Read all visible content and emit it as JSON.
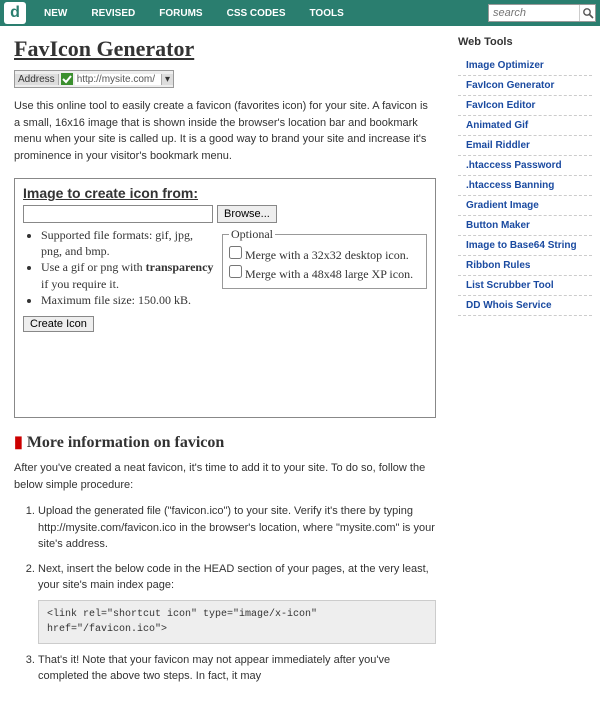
{
  "nav": {
    "items": [
      "NEW",
      "REVISED",
      "FORUMS",
      "CSS CODES",
      "TOOLS"
    ],
    "search_placeholder": "search"
  },
  "page": {
    "title": "FavIcon Generator",
    "address_label": "Address",
    "address_url": "http://mysite.com/",
    "intro": "Use this online tool to easily create a favicon (favorites icon) for your site. A favicon is a small, 16x16 image that is shown inside the browser's location bar and bookmark menu when your site is called up. It is a good way to brand your site and increase it's prominence in your visitor's bookmark menu."
  },
  "form": {
    "heading": "Image to create icon from:",
    "browse_label": "Browse...",
    "notes": [
      "Supported file formats: gif, jpg, png, and bmp.",
      "Use a gif or png with <b>transparency</b> if you require it.",
      "Maximum file size: 150.00 kB."
    ],
    "optional_legend": "Optional",
    "opt1": "Merge with a 32x32 desktop icon.",
    "opt2": "Merge with a 48x48 large XP icon.",
    "create_label": "Create Icon"
  },
  "more": {
    "heading": "More information on favicon",
    "after": "After you've created a neat favicon, it's time to add it to your site. To do so, follow the below simple procedure:",
    "step1": "Upload the generated file (\"favicon.ico\") to your site. Verify it's there by typing http://mysite.com/favicon.ico in the browser's location, where \"mysite.com\" is your site's address.",
    "step2": "Next, insert the below code in the HEAD section of your pages, at the very least, your site's main index page:",
    "code": "<link rel=\"shortcut icon\" type=\"image/x-icon\" href=\"/favicon.ico\">",
    "step3": "That's it! Note that your favicon may not appear immediately after you've completed the above two steps. In fact, it may"
  },
  "sidebar": {
    "title": "Web Tools",
    "links": [
      "Image Optimizer",
      "FavIcon Generator",
      "FavIcon Editor",
      "Animated Gif",
      "Email Riddler",
      ".htaccess Password",
      ".htaccess Banning",
      "Gradient Image",
      "Button Maker",
      "Image to Base64 String",
      "Ribbon Rules",
      "List Scrubber Tool",
      "DD Whois Service"
    ]
  }
}
